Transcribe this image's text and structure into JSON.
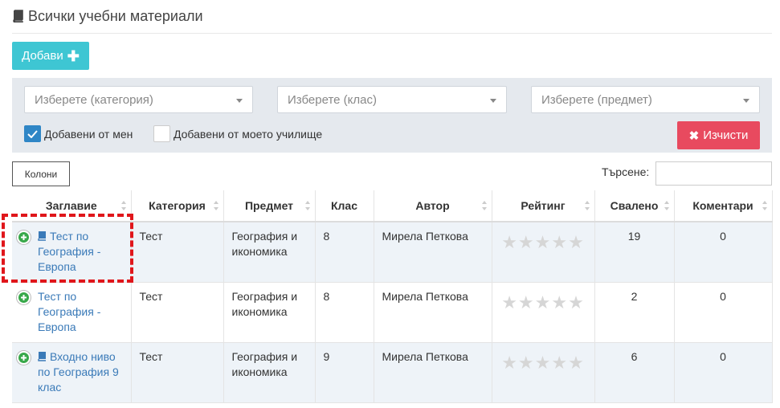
{
  "header": {
    "title": "Всички учебни материали",
    "icon": "book-icon"
  },
  "toolbar": {
    "add_label": "Добави"
  },
  "filters": {
    "category_placeholder": "Изберете (категория)",
    "class_placeholder": "Изберете (клас)",
    "subject_placeholder": "Изберете (предмет)",
    "added_by_me": {
      "label": "Добавени от мен",
      "checked": true
    },
    "added_by_school": {
      "label": "Добавени от моето училище",
      "checked": false
    },
    "clear_label": "Изчисти"
  },
  "table_controls": {
    "columns_label": "Колони",
    "search_label": "Търсене:",
    "search_value": ""
  },
  "table": {
    "headers": [
      "Заглавие",
      "Категория",
      "Предмет",
      "Клас",
      "Автор",
      "Рейтинг",
      "Свалено",
      "Коментари"
    ],
    "rows": [
      {
        "title": "Тест по География - Европа",
        "category": "Тест",
        "subject": "География и икономика",
        "grade": "8",
        "author": "Мирела Петкова",
        "stars": "★★★★★",
        "rating": 0,
        "downloads": "19",
        "comments": "0"
      },
      {
        "title": "Тест по География - Европа",
        "category": "Тест",
        "subject": "География и икономика",
        "grade": "8",
        "author": "Мирела Петкова",
        "stars": "★★★★★",
        "rating": 0,
        "downloads": "2",
        "comments": "0"
      },
      {
        "title": "Входно ниво по География 9 клас",
        "category": "Тест",
        "subject": "География и икономика",
        "grade": "9",
        "author": "Мирела Петкова",
        "stars": "★★★★★",
        "rating": 0,
        "downloads": "6",
        "comments": "0"
      }
    ]
  },
  "colors": {
    "add_button": "#3ec6d3",
    "clear_button": "#e84a5f",
    "link": "#3a7ab8",
    "checkbox": "#2f86c6",
    "highlight": "#e0161b"
  }
}
